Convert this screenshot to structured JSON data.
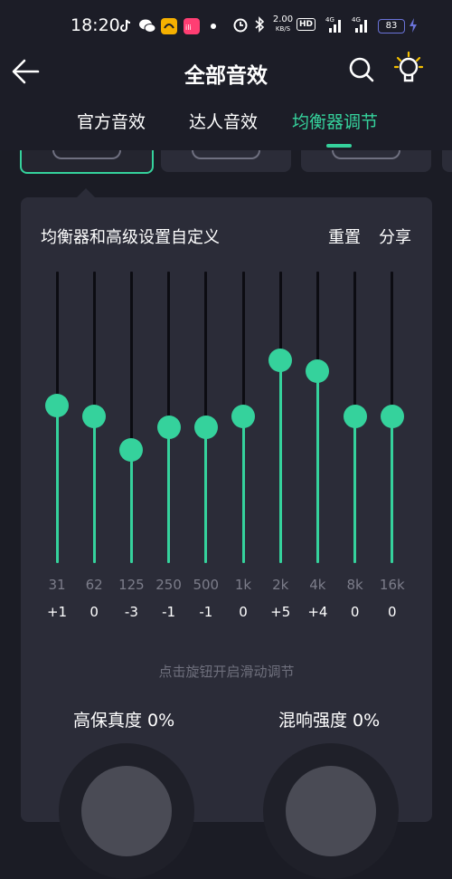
{
  "status_bar": {
    "time": "18:20",
    "net_speed_value": "2.00",
    "net_speed_unit": "KB/S",
    "hd_label": "HD",
    "signal_1_tag": "4G",
    "signal_2_tag": "4G",
    "battery": "83",
    "app_icon_colors": [
      "#ffffff",
      "#3fb34f",
      "#f5b000",
      "#ff3e73"
    ]
  },
  "header": {
    "title": "全部音效",
    "back_icon": "arrow-left-icon",
    "search_icon": "search-icon",
    "tip_icon": "lightbulb-icon"
  },
  "tabs": [
    {
      "label": "官方音效",
      "active": false
    },
    {
      "label": "达人音效",
      "active": false
    },
    {
      "label": "均衡器调节",
      "active": true
    }
  ],
  "panel": {
    "title": "均衡器和高级设置自定义",
    "reset_label": "重置",
    "share_label": "分享",
    "hint": "点击旋钮开启滑动调节"
  },
  "equalizer": {
    "range_db": [
      -12,
      12
    ],
    "bands": [
      {
        "freq": "31",
        "gain_label": "+1",
        "gain": 1
      },
      {
        "freq": "62",
        "gain_label": "0",
        "gain": 0
      },
      {
        "freq": "125",
        "gain_label": "-3",
        "gain": -3
      },
      {
        "freq": "250",
        "gain_label": "-1",
        "gain": -1
      },
      {
        "freq": "500",
        "gain_label": "-1",
        "gain": -1
      },
      {
        "freq": "1k",
        "gain_label": "0",
        "gain": 0
      },
      {
        "freq": "2k",
        "gain_label": "+5",
        "gain": 5
      },
      {
        "freq": "4k",
        "gain_label": "+4",
        "gain": 4
      },
      {
        "freq": "8k",
        "gain_label": "0",
        "gain": 0
      },
      {
        "freq": "16k",
        "gain_label": "0",
        "gain": 0
      }
    ]
  },
  "effects": {
    "fidelity_label": "高保真度 0%",
    "reverb_label": "混响强度 0%"
  },
  "colors": {
    "accent": "#35d29c",
    "background": "#1b1c25",
    "panel": "#2b2c38",
    "track": "#0c0c12"
  }
}
